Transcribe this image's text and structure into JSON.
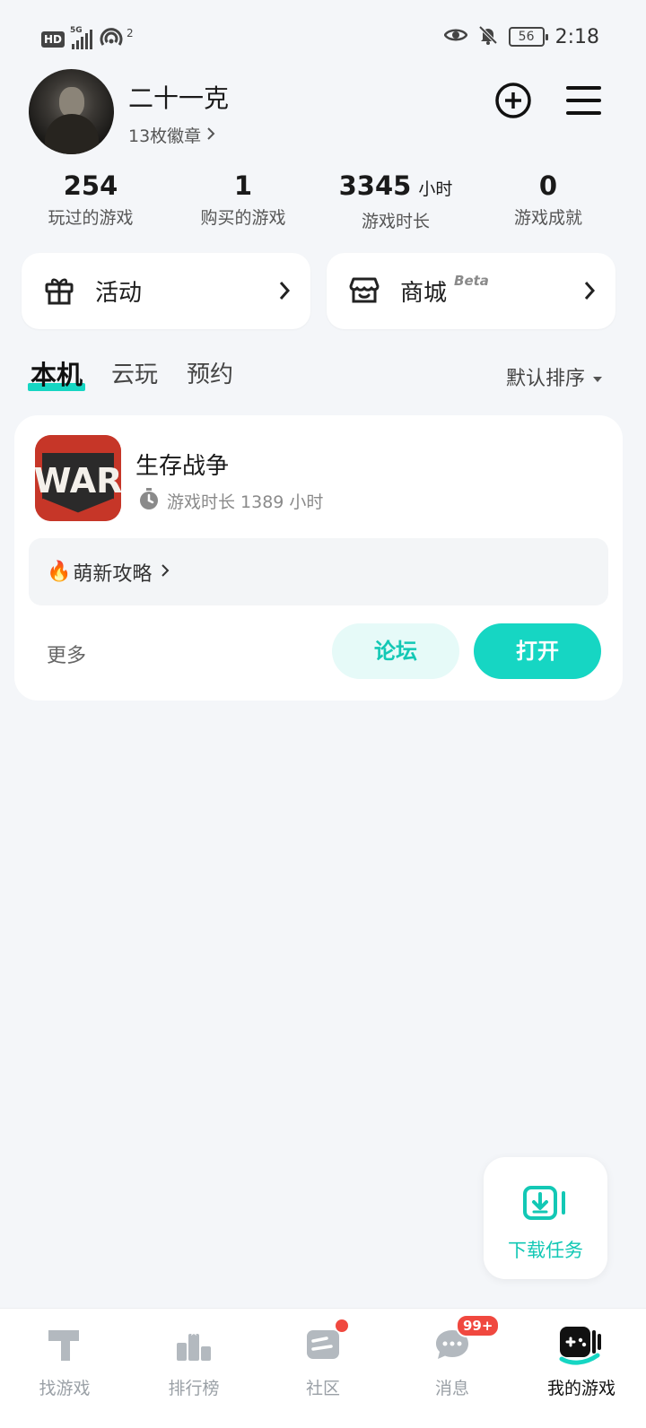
{
  "status_bar": {
    "hd": "HD",
    "network": "5G",
    "hotspot_count": "2",
    "battery": "56",
    "time": "2:18"
  },
  "profile": {
    "username": "二十一克",
    "badges": "13枚徽章"
  },
  "stats": [
    {
      "value": "254",
      "unit": "",
      "label": "玩过的游戏"
    },
    {
      "value": "1",
      "unit": "",
      "label": "购买的游戏"
    },
    {
      "value": "3345",
      "unit": "小时",
      "label": "游戏时长"
    },
    {
      "value": "0",
      "unit": "",
      "label": "游戏成就"
    }
  ],
  "cards": {
    "activity": "活动",
    "mall": "商城",
    "mall_beta": "Beta"
  },
  "tabs": [
    {
      "label": "本机",
      "active": true
    },
    {
      "label": "云玩",
      "active": false
    },
    {
      "label": "预约",
      "active": false
    }
  ],
  "sort_label": "默认排序",
  "game": {
    "icon_text": "WAR",
    "title": "生存战争",
    "playtime": "游戏时长 1389 小时",
    "guide": "萌新攻略",
    "more": "更多",
    "forum": "论坛",
    "open": "打开"
  },
  "download_tasks": "下载任务",
  "bottom_nav": [
    {
      "label": "找游戏",
      "active": false
    },
    {
      "label": "排行榜",
      "active": false
    },
    {
      "label": "社区",
      "active": false
    },
    {
      "label": "消息",
      "active": false,
      "badge": "99+"
    },
    {
      "label": "我的游戏",
      "active": true
    }
  ],
  "colors": {
    "accent": "#16d6c3",
    "accent_text": "#13c8b5",
    "badge_red": "#f0483f",
    "game_icon_red": "#c63628"
  }
}
